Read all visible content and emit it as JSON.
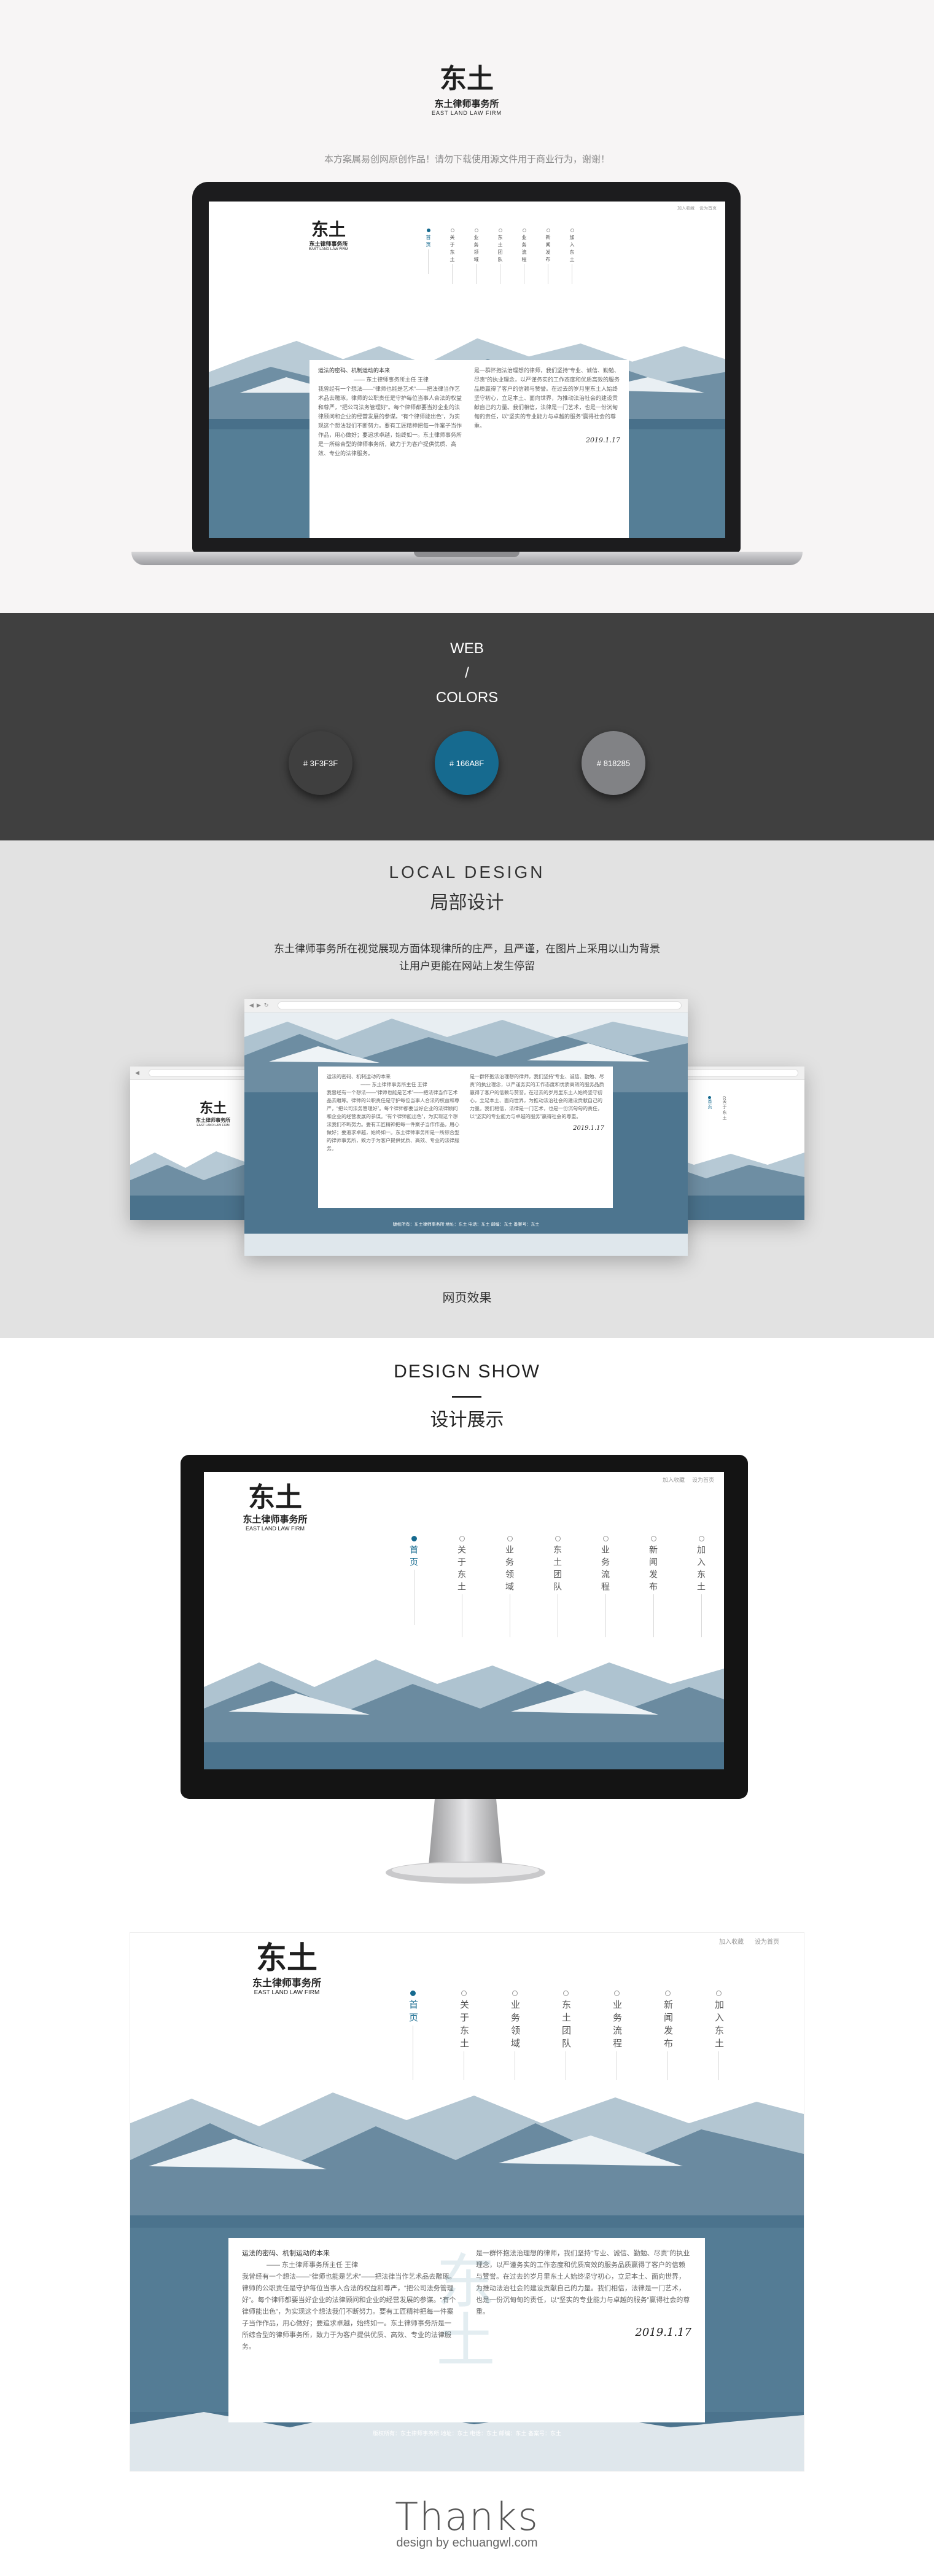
{
  "hero": {
    "logo_mark": "东土",
    "firm_cn": "东土律师事务所",
    "firm_en": "EAST LAND LAW FIRM",
    "notice": "本方案属易创网原创作品！请勿下载使用源文件用于商业行为，谢谢！"
  },
  "site": {
    "top_links": [
      "加入收藏",
      "设为首页"
    ],
    "nav": [
      {
        "label": "首页",
        "active": true
      },
      {
        "label": "关于东土",
        "active": false
      },
      {
        "label": "业务领域",
        "active": false
      },
      {
        "label": "东土团队",
        "active": false
      },
      {
        "label": "业务流程",
        "active": false
      },
      {
        "label": "新闻发布",
        "active": false
      },
      {
        "label": "加入东土",
        "active": false
      }
    ],
    "card_heading": "运法的密码、机制运动的本来",
    "card_sub": "—— 东土律师事务所主任 王律",
    "card_left": "我曾经有一个想法——“律师也能是艺术”——把法律当作艺术品去雕琢。律师的公职责任是守护每位当事人合法的权益和尊严，“把公司法务管理好”。每个律师都要当好企业的法律顾问和企业的经营发展的参谋。“有个律师能出色”，为实现这个想法我们不断努力。要有工匠精神把每一件案子当作作品，用心做好；要追求卓越，始终如一。东土律师事务所是一所综合型的律师事务所，致力于为客户提供优质、高效、专业的法律服务。",
    "card_right": "是一群怀抱法治理想的律师，我们坚持“专业、诚信、勤勉、尽责”的执业理念，以严谨务实的工作态度和优质高效的服务品质赢得了客户的信赖与赞誉。在过去的岁月里东土人始终坚守初心，立足本土、面向世界，为推动法治社会的建设贡献自己的力量。我们相信，法律是一门艺术，也是一份沉甸甸的责任，以“坚实的专业能力与卓越的服务”赢得社会的尊重。",
    "signature": "2019.1.17",
    "watermark": "东土",
    "footer": "版权所有：东土律师事务所  地址：东土  电话：东土  邮编：东土  备案号：东土"
  },
  "colors": {
    "title_lines": [
      "WEB",
      "/",
      "COLORS"
    ],
    "swatches": [
      {
        "hex": "#3F3F3F",
        "label": "# 3F3F3F"
      },
      {
        "hex": "#166A8F",
        "label": "# 166A8F"
      },
      {
        "hex": "#818285",
        "label": "# 818285"
      }
    ]
  },
  "local": {
    "title_en": "LOCAL  DESIGN",
    "title_cn": "局部设计",
    "desc_1": "东土律师事务所在视觉展现方面体现律所的庄严，且严谨，在图片上采用以山为背景",
    "desc_2": "让用户更能在网站上发生停留",
    "browser_buttons": [
      "◀",
      "▶",
      "↻"
    ],
    "caption": "网页效果"
  },
  "show": {
    "title_en": "DESIGN SHOW",
    "title_cn": "设计展示",
    "thanks": "Thanks",
    "credit": "design by echuangwl.com"
  }
}
